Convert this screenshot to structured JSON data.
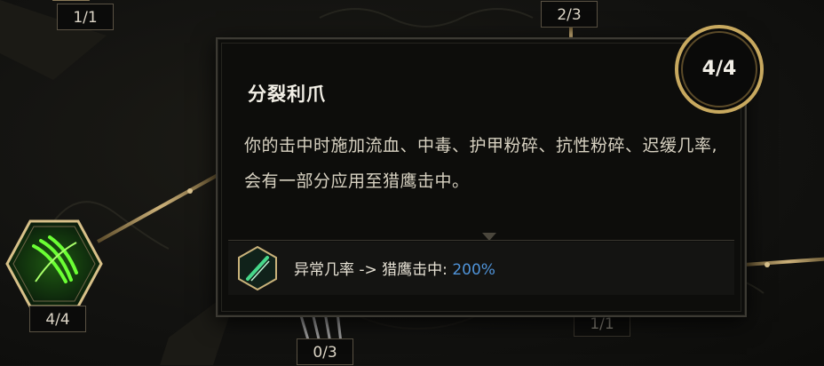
{
  "skill_tree": {
    "counters": {
      "top_left": "1/1",
      "top_center": "2/3",
      "left_node": "4/4",
      "bottom_center": "0/3",
      "bottom_right": "1/1"
    }
  },
  "tooltip": {
    "points": "4/4",
    "title": "分裂利爪",
    "description": "你的击中时施加流血、中毒、护甲粉碎、抗性粉碎、迟缓几率, 会有一部分应用至猎鹰击中。",
    "stat": {
      "label": "异常几率 -> 猎鹰击中: ",
      "value": "200%",
      "value_color": "#4f93d8",
      "icon": "blade-icon"
    }
  }
}
